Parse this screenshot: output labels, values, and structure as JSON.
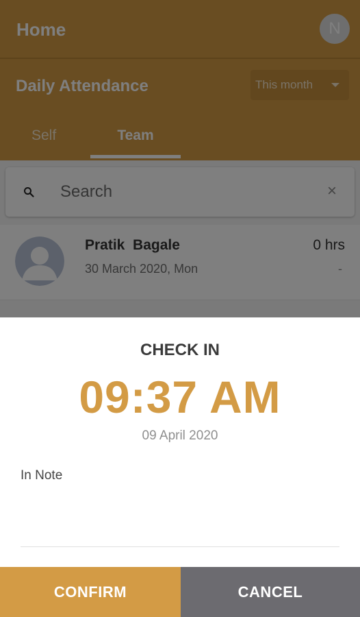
{
  "appbar": {
    "title": "Home",
    "avatar_initial": "N"
  },
  "attendance": {
    "title": "Daily Attendance",
    "period": "This month",
    "tabs": [
      {
        "label": "Self",
        "selected": false
      },
      {
        "label": "Team",
        "selected": true
      }
    ]
  },
  "search": {
    "placeholder": "Search"
  },
  "team_list": [
    {
      "name": "Pratik  Bagale",
      "date": "30 March 2020, Mon",
      "hours": "0 hrs",
      "status": "-"
    }
  ],
  "check_in_sheet": {
    "heading": "CHECK IN",
    "time": "09:37 AM",
    "date": "09 April 2020",
    "note_label": "In Note",
    "note_value": "",
    "confirm_label": "CONFIRM",
    "cancel_label": "CANCEL"
  },
  "colors": {
    "brand": "#d39b45",
    "cancel": "#6c6b70",
    "scrim": "rgba(0,0,0,0.5)"
  },
  "icons": [
    "search-icon",
    "close-icon",
    "chevron-down-icon",
    "person-icon"
  ]
}
